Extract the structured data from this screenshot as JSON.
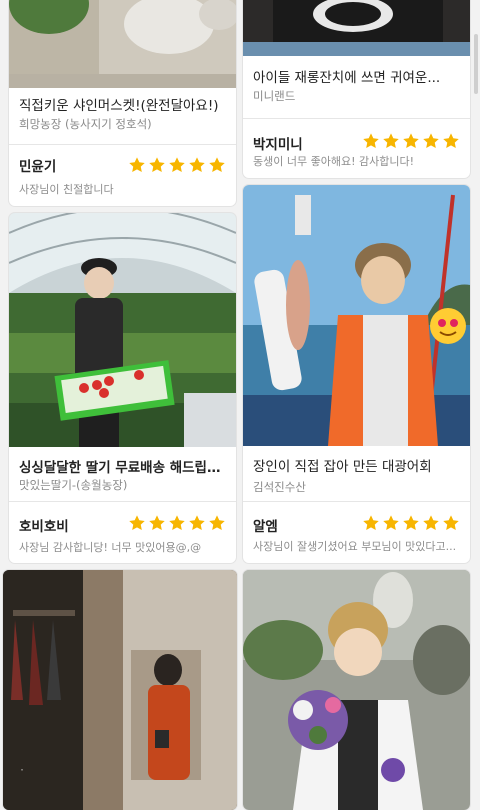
{
  "cards": [
    {
      "title": "직접키운 샤인머스켓!(완전달아요!)",
      "shop": "희망농장 (농사지기 정호석)",
      "reviewer": "민윤기",
      "rating": 5,
      "comment": "사장님이 친절합니다"
    },
    {
      "title": "아이들 재롱잔치에 쓰면 귀여운...",
      "shop": "미니랜드",
      "reviewer": "박지미니",
      "rating": 5,
      "comment": "동생이 너무 좋아해요! 감사합니다!"
    },
    {
      "title": "싱싱달달한 딸기 무료배송 해드립니다.",
      "shop": "맛있는딸기-(송월농장)",
      "reviewer": "호비호비",
      "rating": 5,
      "comment": "사장님 감사합니당! 너무 맛있어용@,@"
    },
    {
      "title": "장인이 직접 잡아 만든 대광어회",
      "shop": "김석진수산",
      "reviewer": "알엠",
      "rating": 5,
      "comment": "사장님이 잘생기셨어요 부모님이 맛있다고..."
    }
  ],
  "colors": {
    "star": "#f7b500",
    "background": "#f2f2f2"
  }
}
